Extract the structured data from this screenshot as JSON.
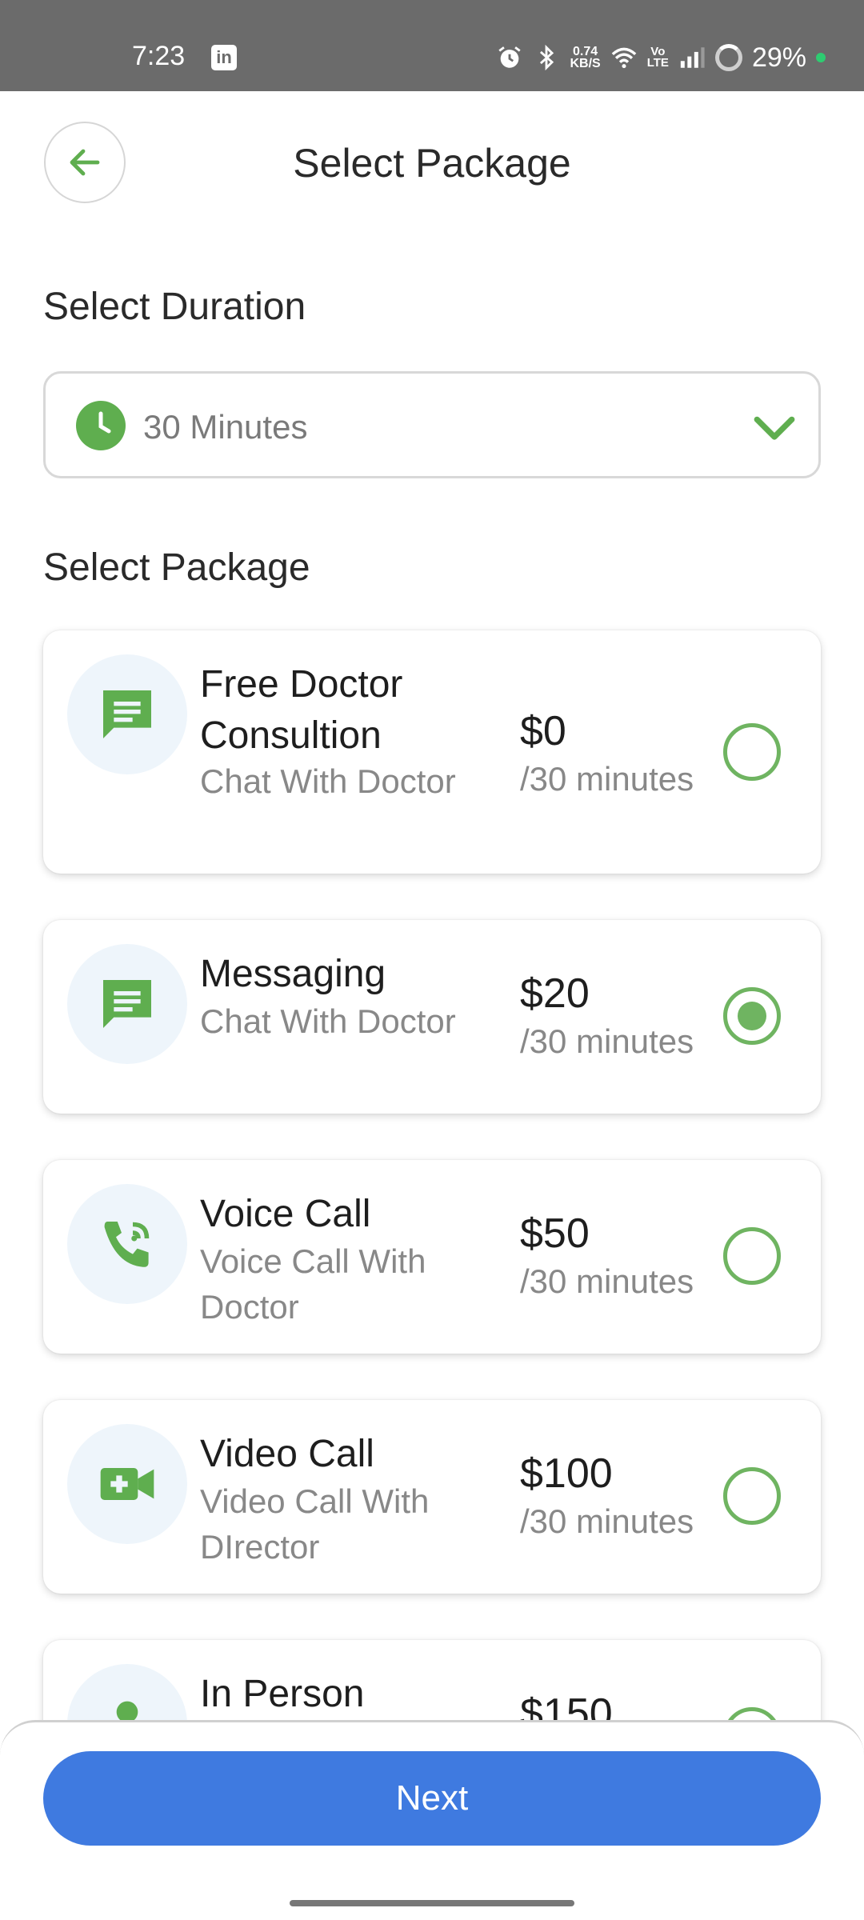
{
  "status_bar": {
    "time": "7:23",
    "net_speed_value": "0.74",
    "net_speed_unit": "KB/S",
    "volte_line1": "Vo",
    "volte_line2": "LTE",
    "battery": "29%"
  },
  "header": {
    "title": "Select Package",
    "back_icon": "arrow-left-icon"
  },
  "duration": {
    "label": "Select Duration",
    "selected": "30 Minutes",
    "icon": "clock-icon"
  },
  "packages": {
    "label": "Select Package",
    "items": [
      {
        "name": "Free Doctor Consultion",
        "desc": "Chat With Doctor",
        "price": "$0",
        "per": "/30 minutes",
        "icon": "chat-icon",
        "selected": false
      },
      {
        "name": "Messaging",
        "desc": "Chat With Doctor",
        "price": "$20",
        "per": "/30 minutes",
        "icon": "chat-icon",
        "selected": true
      },
      {
        "name": "Voice Call",
        "desc": "Voice Call With Doctor",
        "price": "$50",
        "per": "/30 minutes",
        "icon": "phone-call-icon",
        "selected": false
      },
      {
        "name": "Video Call",
        "desc": "Video Call With DIrector",
        "price": "$100",
        "per": "/30 minutes",
        "icon": "video-call-icon",
        "selected": false
      },
      {
        "name": "In Person",
        "desc": "",
        "price": "$150",
        "per": "",
        "icon": "person-icon",
        "selected": false
      }
    ]
  },
  "footer": {
    "next_label": "Next"
  },
  "colors": {
    "accent_green": "#5fae4f",
    "button_blue": "#3f7ae0",
    "status_bar": "#6b6b6b"
  }
}
